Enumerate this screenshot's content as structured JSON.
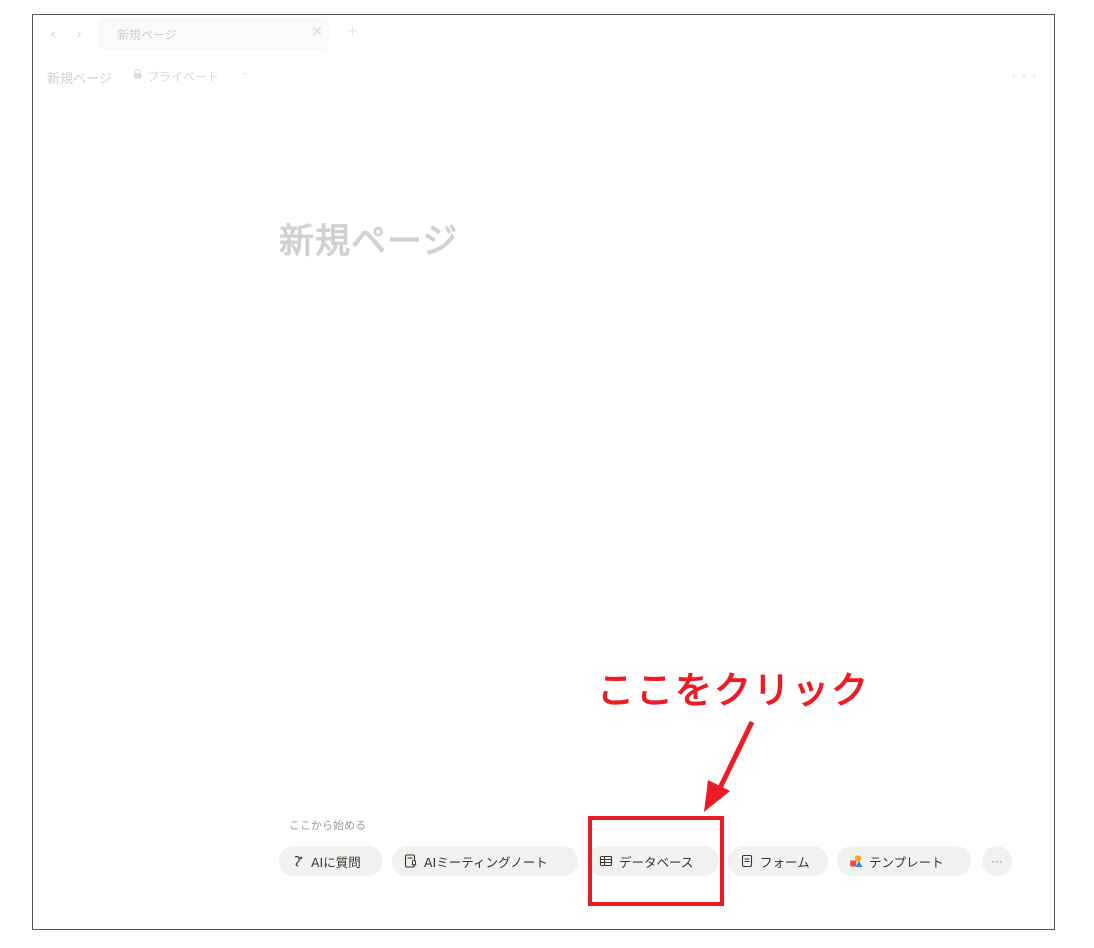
{
  "tab": {
    "title": "新規ページ"
  },
  "breadcrumb": {
    "page": "新規ページ",
    "visibility": "プライベート"
  },
  "page": {
    "title": "新規ページ"
  },
  "starter": {
    "label": "ここから始める",
    "chips": [
      {
        "label": "AIに質問",
        "icon": "ai-sparkle-icon"
      },
      {
        "label": "AIミーティングノート",
        "icon": "meeting-note-icon"
      },
      {
        "label": "データベース",
        "icon": "table-icon"
      },
      {
        "label": "フォーム",
        "icon": "form-icon"
      },
      {
        "label": "テンプレート",
        "icon": "template-shapes-icon"
      }
    ],
    "more": "···"
  },
  "annotation": {
    "text": "ここをクリック",
    "color": "#ec1c24"
  }
}
